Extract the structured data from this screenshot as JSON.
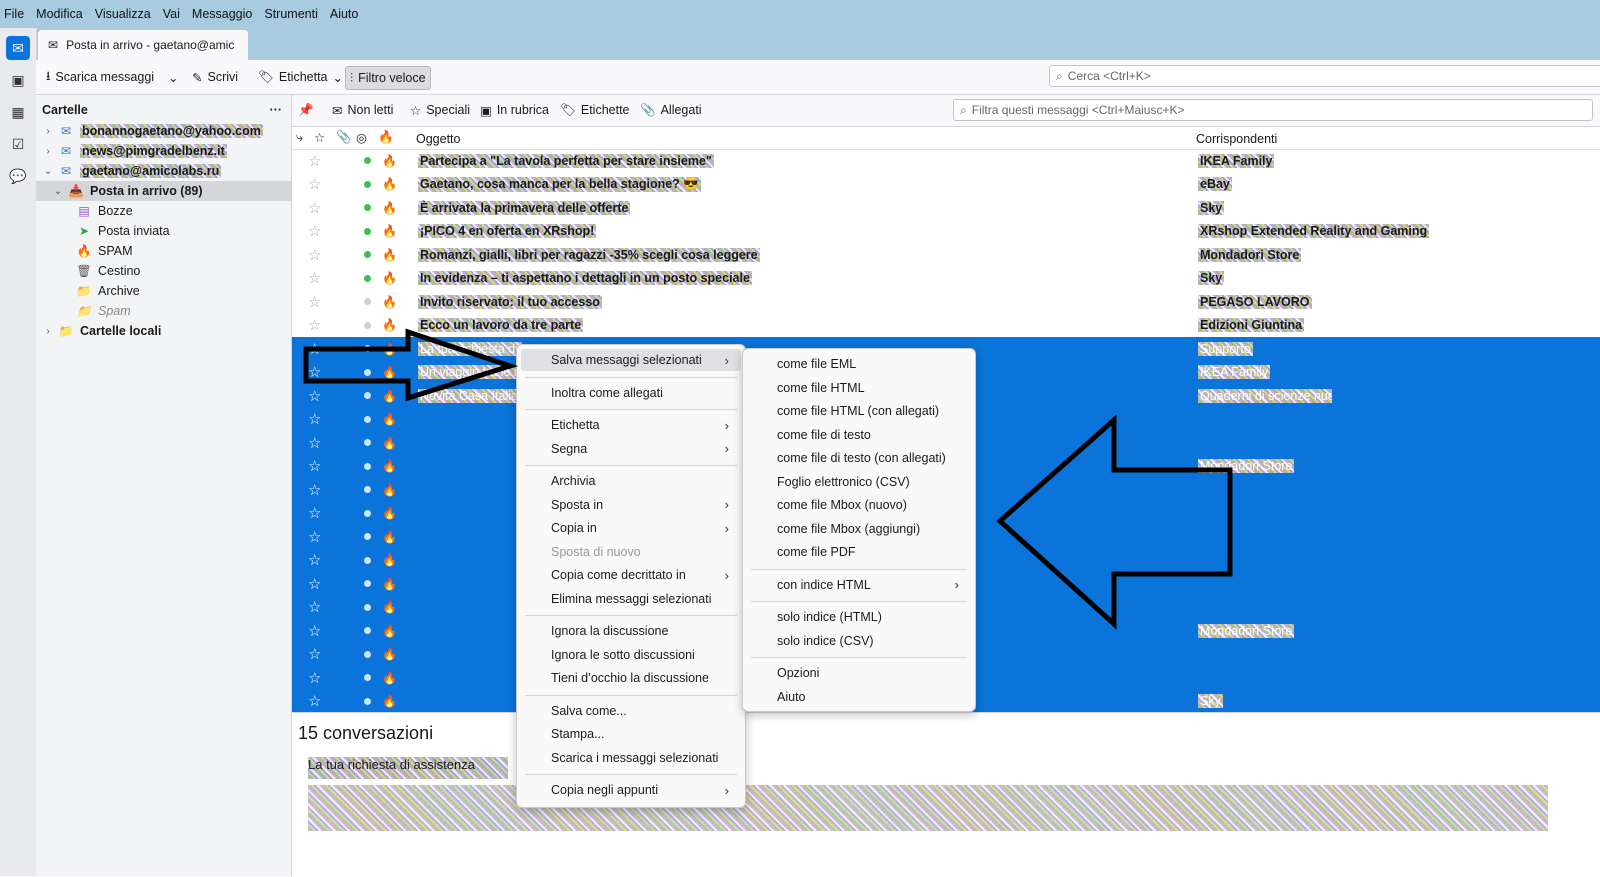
{
  "menubar": [
    "File",
    "Modifica",
    "Visualizza",
    "Vai",
    "Messaggio",
    "Strumenti",
    "Aiuto"
  ],
  "tab": {
    "title": "Posta in arrivo - gaetano@amic"
  },
  "toolbar": {
    "get_messages": "Scarica messaggi",
    "write": "Scrivi",
    "tag": "Etichetta",
    "quick_filter": "Filtro veloce",
    "search_placeholder": "Cerca <Ctrl+K>"
  },
  "folders": {
    "header": "Cartelle",
    "more": "···",
    "items": [
      {
        "label": "bonannogaetano@yahoo.com",
        "bold": true
      },
      {
        "label": "news@pimgradelbenz.it",
        "bold": true
      },
      {
        "label": "gaetano@amicolabs.ru",
        "bold": true
      },
      {
        "label": "Posta in arrivo (89)",
        "bold": true
      },
      {
        "label": "Bozze"
      },
      {
        "label": "Posta inviata"
      },
      {
        "label": "SPAM"
      },
      {
        "label": "Cestino"
      },
      {
        "label": "Archive"
      },
      {
        "label": "Spam"
      },
      {
        "label": "Cartelle locali",
        "bold": true
      }
    ]
  },
  "quickfilter": {
    "unread": "Non letti",
    "starred": "Speciali",
    "contacts": "In rubrica",
    "tags": "Etichette",
    "attachments": "Allegati",
    "search_placeholder": "Filtra questi messaggi <Ctrl+Maiusc+K>"
  },
  "columns": {
    "subject": "Oggetto",
    "correspondents": "Corrispondenti"
  },
  "messages": [
    {
      "subject": "Partecipa a \"La tavola perfetta per stare insieme\"",
      "corr": "IKEA Family"
    },
    {
      "subject": "Gaetano, cosa manca per la bella stagione? 😎",
      "corr": "eBay"
    },
    {
      "subject": "È arrivata la primavera delle offerte",
      "corr": "Sky"
    },
    {
      "subject": "¡PICO 4 en oferta en XRshop!",
      "corr": "XRshop Extended Reality and Gaming"
    },
    {
      "subject": "Romanzi, gialli, libri per ragazzi -35% scegli cosa leggere",
      "corr": "Mondadori Store"
    },
    {
      "subject": "In evidenza – ti aspettano i dettagli in un posto speciale",
      "corr": "Sky"
    },
    {
      "subject": "Invito riservato: il tuo accesso",
      "corr": "PEGASO LAVORO"
    },
    {
      "subject": "Ecco un lavoro da tre parte",
      "corr": "Edizioni Giuntina"
    },
    {
      "subject": "La tua richiesta di assistenza",
      "corr": "Supporto"
    },
    {
      "subject": "Un viaggio tra le novità",
      "corr": "IKEA Family"
    },
    {
      "subject": "Novità Casa Italia",
      "corr": "Quaderni di scienze nuote"
    },
    {
      "subject": "",
      "corr": ""
    },
    {
      "subject": "",
      "corr": ""
    },
    {
      "subject": "",
      "corr": "Mondadori Store"
    },
    {
      "subject": "",
      "corr": ""
    },
    {
      "subject": "",
      "corr": ""
    },
    {
      "subject": "",
      "corr": ""
    },
    {
      "subject": "",
      "corr": ""
    },
    {
      "subject": "",
      "corr": ""
    },
    {
      "subject": "",
      "corr": ""
    },
    {
      "subject": "",
      "corr": "Mondadori Store"
    },
    {
      "subject": "",
      "corr": ""
    },
    {
      "subject": "",
      "corr": ""
    },
    {
      "subject": "",
      "corr": "Sky"
    }
  ],
  "summary": {
    "count_label": "15 conversazioni",
    "preview": "La tua richiesta di assistenza"
  },
  "context_menu": [
    {
      "label": "Salva messaggi selezionati",
      "sub": true,
      "hl": true
    },
    {
      "sep": true
    },
    {
      "label": "Inoltra come allegati"
    },
    {
      "sep": true
    },
    {
      "label": "Etichetta",
      "sub": true
    },
    {
      "label": "Segna",
      "sub": true
    },
    {
      "sep": true
    },
    {
      "label": "Archivia"
    },
    {
      "label": "Sposta in",
      "sub": true
    },
    {
      "label": "Copia in",
      "sub": true
    },
    {
      "label": "Sposta di nuovo",
      "dis": true
    },
    {
      "label": "Copia come decrittato in",
      "sub": true
    },
    {
      "label": "Elimina messaggi selezionati"
    },
    {
      "sep": true
    },
    {
      "label": "Ignora la discussione"
    },
    {
      "label": "Ignora le sotto discussioni"
    },
    {
      "label": "Tieni d’occhio la discussione"
    },
    {
      "sep": true
    },
    {
      "label": "Salva come..."
    },
    {
      "label": "Stampa..."
    },
    {
      "label": "Scarica i messaggi selezionati"
    },
    {
      "sep": true
    },
    {
      "label": "Copia negli appunti",
      "sub": true
    }
  ],
  "submenu": [
    {
      "label": "come file EML"
    },
    {
      "label": "come file HTML"
    },
    {
      "label": "come file HTML (con allegati)"
    },
    {
      "label": "come file di testo"
    },
    {
      "label": "come file di testo (con allegati)"
    },
    {
      "label": "Foglio elettronico (CSV)"
    },
    {
      "label": "come file Mbox (nuovo)"
    },
    {
      "label": "come file Mbox (aggiungi)"
    },
    {
      "label": "come file PDF"
    },
    {
      "sep": true
    },
    {
      "label": "con indice HTML",
      "sub": true
    },
    {
      "sep": true
    },
    {
      "label": "solo indice (HTML)"
    },
    {
      "label": "solo indice (CSV)"
    },
    {
      "sep": true
    },
    {
      "label": "Opzioni"
    },
    {
      "label": "Aiuto"
    }
  ],
  "colors": {
    "selection": "#0a74da",
    "unread_dot": "#3fbf4f"
  }
}
